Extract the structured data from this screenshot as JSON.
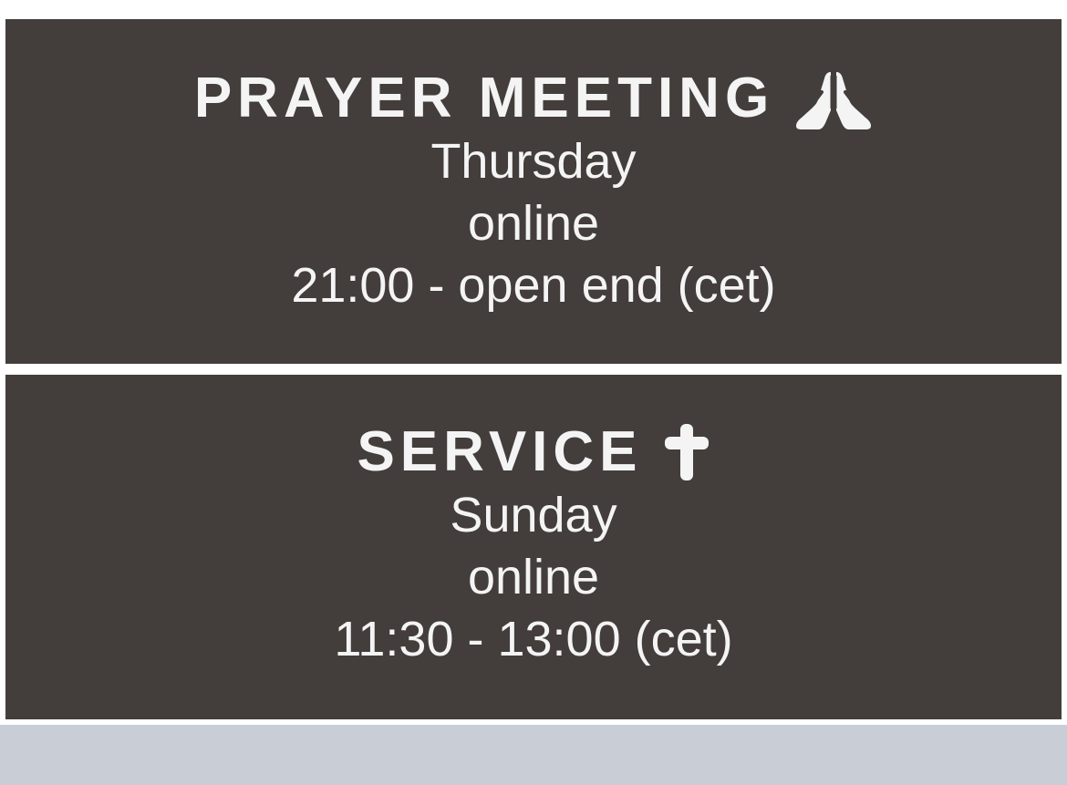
{
  "events": [
    {
      "title": "PRAYER MEETING",
      "icon": "praying-hands-icon",
      "day": "Thursday",
      "location": "online",
      "time": "21:00 - open end (cet)"
    },
    {
      "title": "SERVICE",
      "icon": "cross-icon",
      "day": "Sunday",
      "location": "online",
      "time": "11:30 - 13:00 (cet)"
    }
  ],
  "colors": {
    "card_background": "#433e3b",
    "text": "#f4f4f4",
    "footer_bar": "#c9ced6"
  }
}
